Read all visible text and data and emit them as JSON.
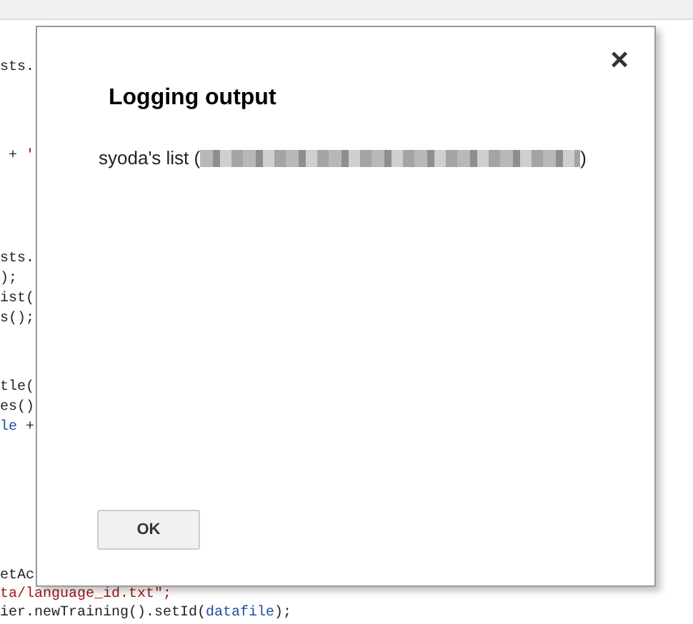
{
  "code_blocks": [
    [
      [
        {
          "text": "sts.",
          "kind": "plain"
        }
      ]
    ],
    [
      [
        {
          "text": " + ",
          "kind": "plain"
        },
        {
          "text": "'",
          "kind": "string"
        }
      ]
    ],
    [
      [
        {
          "text": "sts.",
          "kind": "plain"
        }
      ],
      [
        {
          "text": ");",
          "kind": "plain"
        }
      ],
      [
        {
          "text": "ist(",
          "kind": "plain"
        }
      ],
      [
        {
          "text": "s();",
          "kind": "plain"
        }
      ]
    ],
    [
      [
        {
          "text": "tle(",
          "kind": "plain"
        }
      ],
      [
        {
          "text": "es()",
          "kind": "plain"
        }
      ],
      [
        {
          "text": "le",
          "kind": "keyword"
        },
        {
          "text": " +",
          "kind": "plain"
        }
      ]
    ],
    [
      [
        {
          "text": "etAc",
          "kind": "plain"
        }
      ],
      [
        {
          "text": "ta/language_id.txt\";",
          "kind": "string"
        }
      ],
      [
        {
          "text": "ier.newTraining().setId(",
          "kind": "plain"
        },
        {
          "text": "datafile",
          "kind": "keyword"
        },
        {
          "text": ");",
          "kind": "plain"
        }
      ]
    ]
  ],
  "dialog": {
    "close": "×",
    "title": "Logging output",
    "message_prefix": "syoda's list (",
    "message_suffix": ")",
    "redacted": true,
    "button": "OK"
  }
}
